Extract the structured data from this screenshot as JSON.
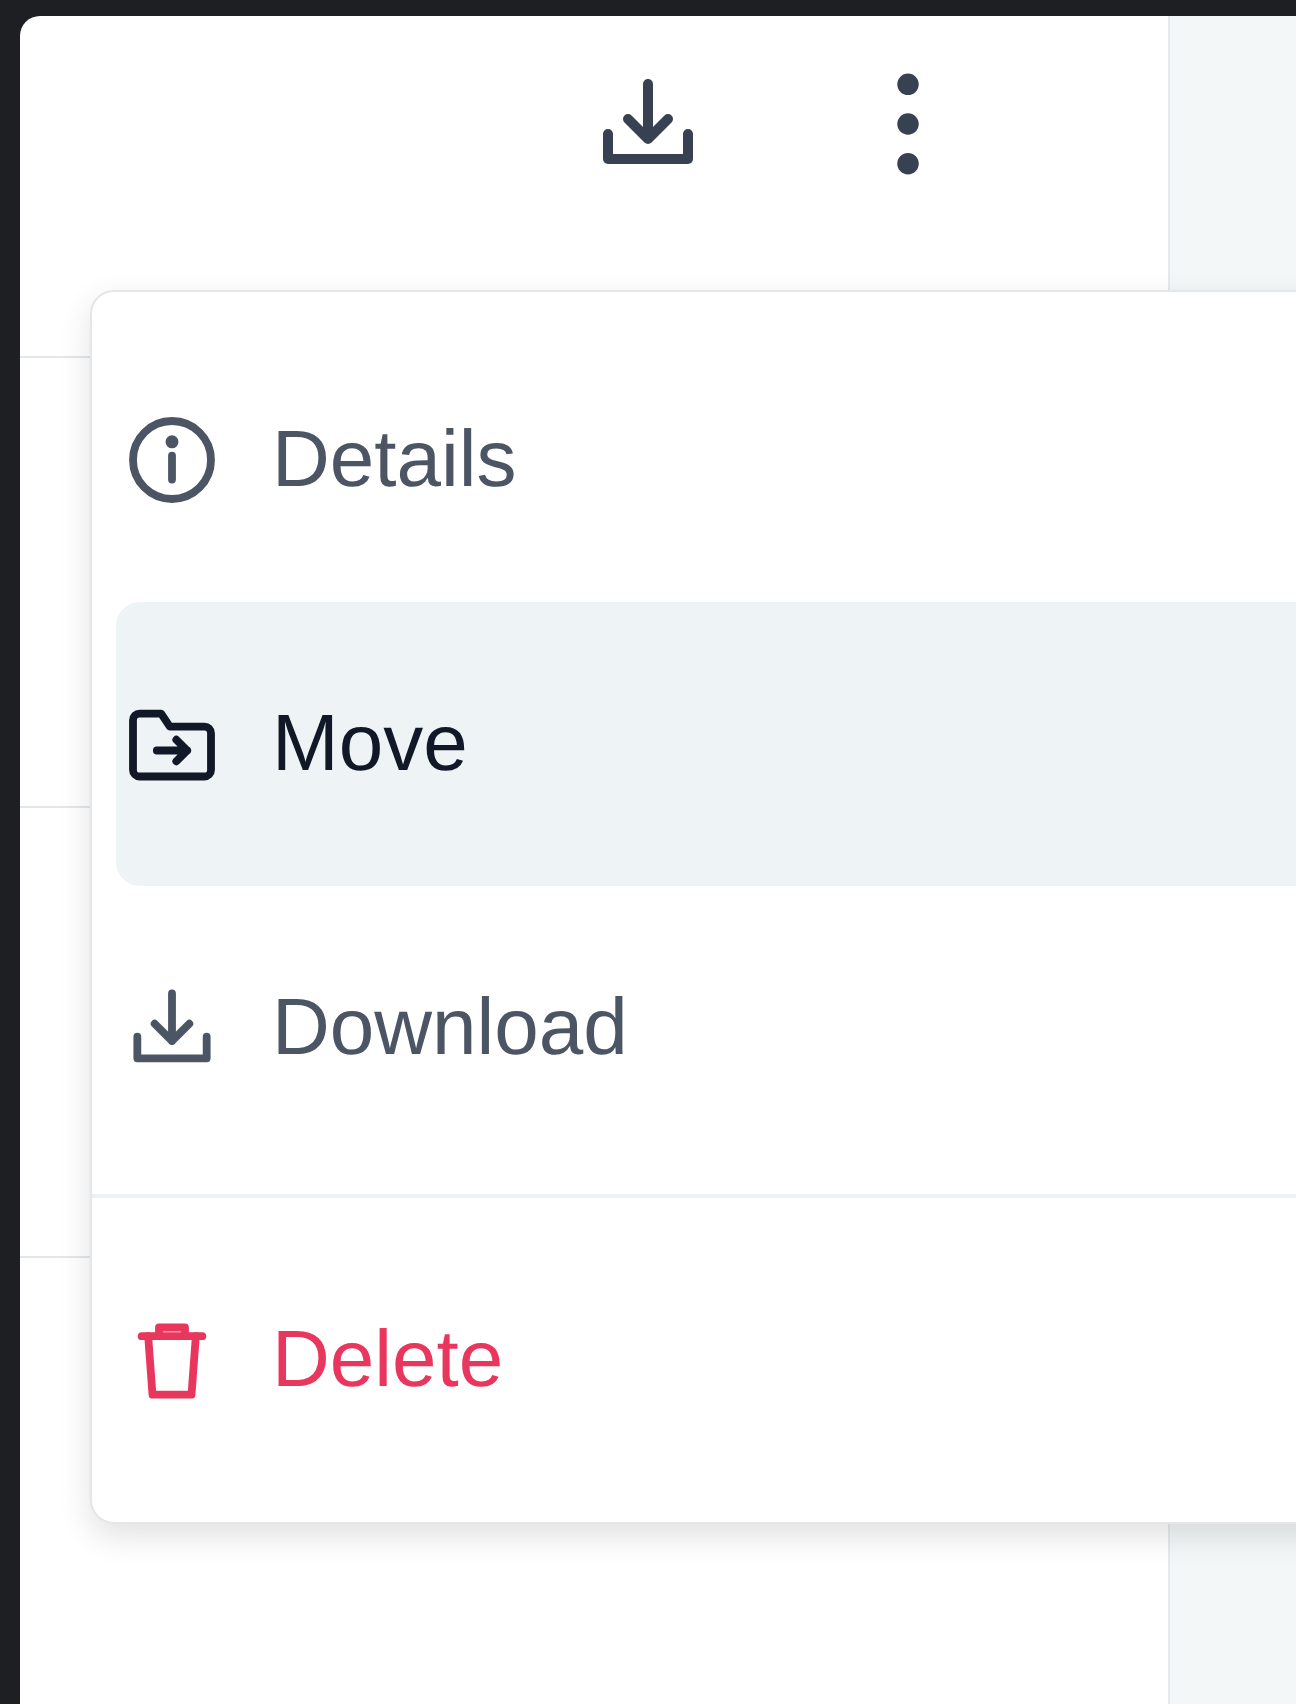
{
  "menu": {
    "items": [
      {
        "label": "Details",
        "kind": "details",
        "selected": false
      },
      {
        "label": "Move",
        "kind": "move",
        "selected": true
      },
      {
        "label": "Download",
        "kind": "download",
        "selected": false
      },
      {
        "label": "Delete",
        "kind": "delete",
        "selected": false
      }
    ]
  }
}
